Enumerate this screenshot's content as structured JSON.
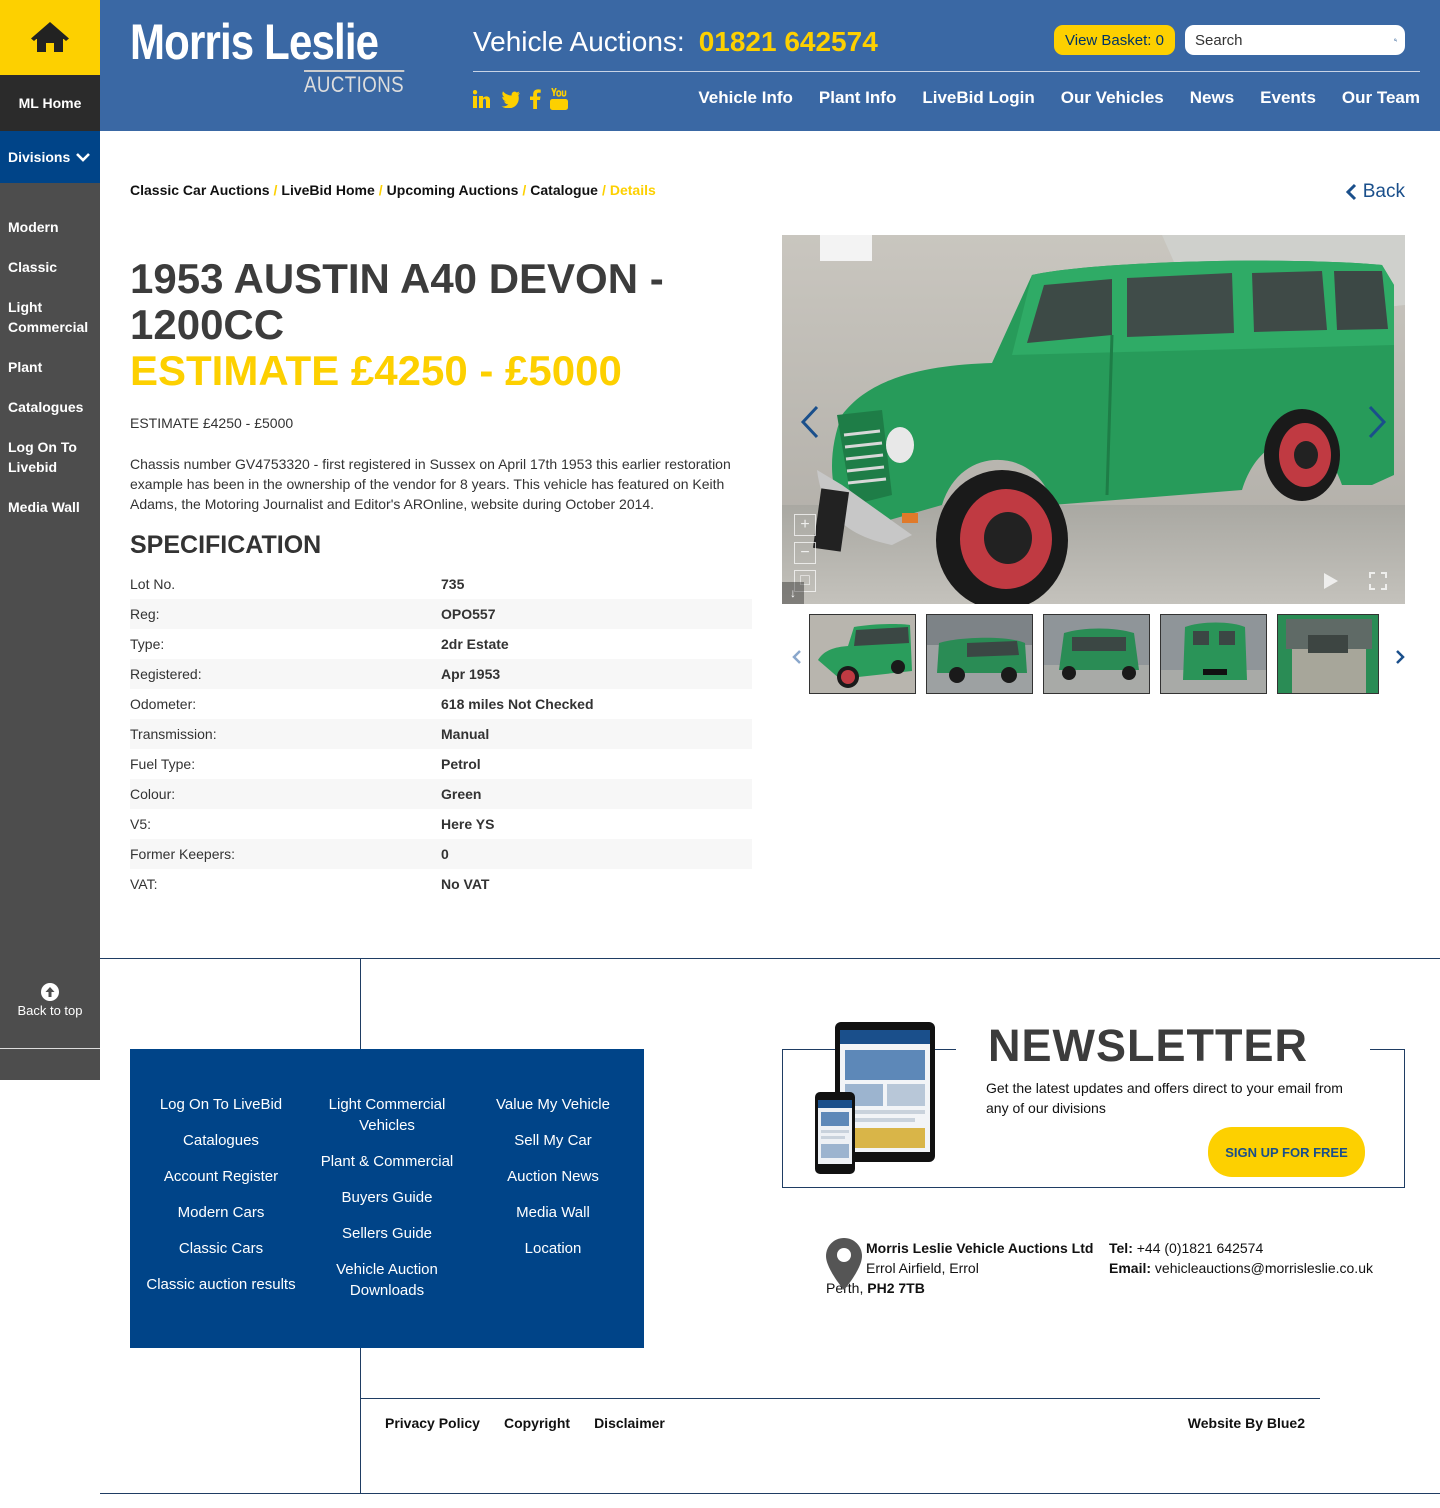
{
  "sidebar": {
    "home_label": "ML Home",
    "divisions_label": "Divisions",
    "items": [
      {
        "label": "Modern"
      },
      {
        "label": "Classic"
      },
      {
        "label": "Light Commercial"
      },
      {
        "label": "Plant"
      },
      {
        "label": "Catalogues"
      },
      {
        "label": "Log On To Livebid"
      },
      {
        "label": "Media Wall"
      }
    ],
    "back_to_top": "Back to top"
  },
  "header": {
    "logo_main": "Morris Leslie",
    "logo_sub": "AUCTIONS",
    "phone_label": "Vehicle Auctions:",
    "phone_number": "01821 642574",
    "basket_label": "View Basket: 0",
    "search_placeholder": "Search",
    "nav": [
      "Vehicle Info",
      "Plant Info",
      "LiveBid Login",
      "Our Vehicles",
      "News",
      "Events",
      "Our Team"
    ],
    "socials": [
      "linkedin-icon",
      "twitter-icon",
      "facebook-icon",
      "youtube-icon"
    ],
    "colors": {
      "header_bg": "#3a68a4",
      "accent": "#fdd000",
      "navy": "#004488"
    }
  },
  "breadcrumb": [
    "Classic Car Auctions",
    "LiveBid Home",
    "Upcoming Auctions",
    "Catalogue",
    "Details"
  ],
  "back_label": "Back",
  "listing": {
    "title": "1953 AUSTIN A40 DEVON - 1200CC",
    "estimate_heading": "ESTIMATE £4250 - £5000",
    "estimate_text": "ESTIMATE £4250 - £5000",
    "description": "Chassis number GV4753320 - first registered in Sussex on April 17th 1953 this earlier restoration example has been in the ownership of the vendor for 8 years. This vehicle has featured on Keith Adams, the Motoring Journalist and Editor's AROnline, website during October 2014.",
    "spec_heading": "SPECIFICATION",
    "spec": [
      {
        "label": "Lot No.",
        "value": "735"
      },
      {
        "label": "Reg:",
        "value": "OPO557"
      },
      {
        "label": "Type:",
        "value": "2dr Estate"
      },
      {
        "label": "Registered:",
        "value": "Apr 1953"
      },
      {
        "label": "Odometer:",
        "value": "618 miles Not Checked"
      },
      {
        "label": "Transmission:",
        "value": "Manual"
      },
      {
        "label": "Fuel Type:",
        "value": "Petrol"
      },
      {
        "label": "Colour:",
        "value": "Green"
      },
      {
        "label": "V5:",
        "value": "Here YS"
      },
      {
        "label": "Former Keepers:",
        "value": "0"
      },
      {
        "label": "VAT:",
        "value": "No VAT"
      }
    ]
  },
  "footer": {
    "columns": [
      [
        "Log On To LiveBid",
        "Catalogues",
        "Account Register",
        "Modern Cars",
        "Classic Cars",
        "Classic auction results"
      ],
      [
        "Light Commercial Vehicles",
        "Plant & Commercial",
        "Buyers Guide",
        "Sellers Guide",
        "Vehicle Auction Downloads"
      ],
      [
        "Value My Vehicle",
        "Sell My Car",
        "Auction News",
        "Media Wall",
        "Location"
      ]
    ],
    "newsletter_title": "NEWSLETTER",
    "newsletter_text": "Get the latest updates and offers direct to your email from any of our divisions",
    "newsletter_button": "SIGN UP FOR FREE",
    "company": "Morris Leslie Vehicle Auctions Ltd",
    "address_line": "Errol Airfield, Errol",
    "town": "Perth,",
    "postcode": "PH2 7TB",
    "tel_label": "Tel:",
    "tel": "+44 (0)1821 642574",
    "email_label": "Email:",
    "email": "vehicleauctions@morrisleslie.co.uk",
    "legal": [
      "Privacy Policy",
      "Copyright",
      "Disclaimer"
    ],
    "credit": "Website By Blue2"
  }
}
